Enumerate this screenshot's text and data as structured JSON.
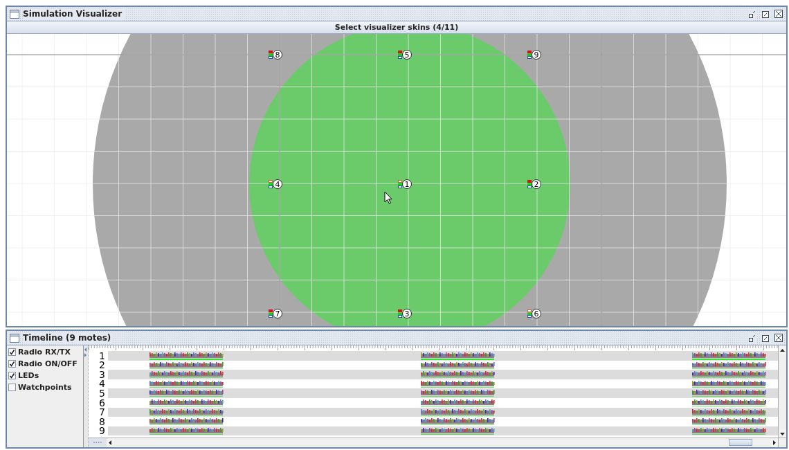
{
  "visualizer": {
    "title": "Simulation Visualizer",
    "skins_button": "Select visualizer skins (4/11)",
    "motes": [
      {
        "label": "8",
        "red_led": true
      },
      {
        "label": "5",
        "red_led": true
      },
      {
        "label": "9",
        "red_led": true
      },
      {
        "label": "4",
        "red_led": false
      },
      {
        "label": "1",
        "red_led": false
      },
      {
        "label": "2",
        "red_led": true
      },
      {
        "label": "7",
        "red_led": true
      },
      {
        "label": "3",
        "red_led": true
      },
      {
        "label": "6",
        "red_led": false
      }
    ]
  },
  "timeline": {
    "title": "Timeline (9 motes)",
    "options": [
      {
        "label": "Radio RX/TX",
        "checked": true
      },
      {
        "label": "Radio ON/OFF",
        "checked": true
      },
      {
        "label": "LEDs",
        "checked": true
      },
      {
        "label": "Watchpoints",
        "checked": false
      }
    ],
    "rows": [
      {
        "label": "1",
        "radio_line": true
      },
      {
        "label": "2",
        "radio_line": false
      },
      {
        "label": "3",
        "radio_line": false
      },
      {
        "label": "4",
        "radio_line": false
      },
      {
        "label": "5",
        "radio_line": false
      },
      {
        "label": "6",
        "radio_line": false
      },
      {
        "label": "7",
        "radio_line": false
      },
      {
        "label": "8",
        "radio_line": false
      },
      {
        "label": "9",
        "radio_line": false
      }
    ]
  }
}
